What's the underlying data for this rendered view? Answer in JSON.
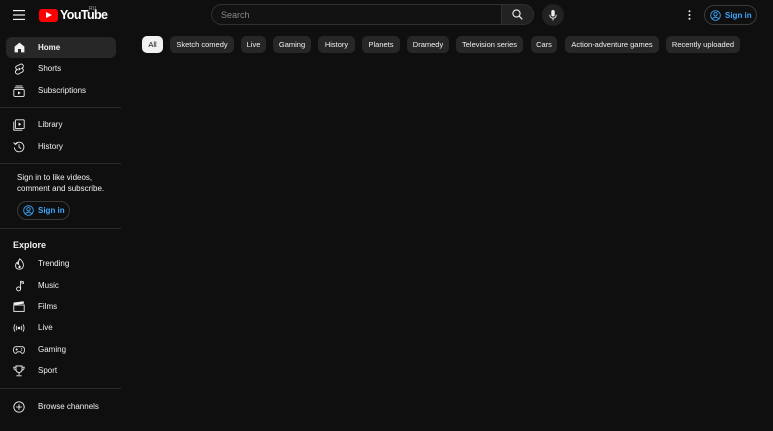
{
  "header": {
    "logo_text": "YouTube",
    "region": "RU",
    "search_placeholder": "Search",
    "sign_in_label": "Sign in",
    "icons": [
      "menu-icon",
      "search-icon",
      "mic-icon",
      "more-vert-icon",
      "account-icon"
    ]
  },
  "sidebar": {
    "main": [
      {
        "label": "Home",
        "icon": "home-icon",
        "active": true
      },
      {
        "label": "Shorts",
        "icon": "shorts-icon"
      },
      {
        "label": "Subscriptions",
        "icon": "subscriptions-icon"
      }
    ],
    "you": [
      {
        "label": "Library",
        "icon": "library-icon"
      },
      {
        "label": "History",
        "icon": "history-icon"
      }
    ],
    "signin_prompt": "Sign in to like videos, comment and subscribe.",
    "signin_label": "Sign in",
    "explore_heading": "Explore",
    "explore": [
      {
        "label": "Trending",
        "icon": "trending-icon"
      },
      {
        "label": "Music",
        "icon": "music-icon"
      },
      {
        "label": "Films",
        "icon": "films-icon"
      },
      {
        "label": "Live",
        "icon": "live-icon"
      },
      {
        "label": "Gaming",
        "icon": "gaming-icon"
      },
      {
        "label": "Sport",
        "icon": "sport-icon"
      }
    ],
    "browse_channels": {
      "label": "Browse channels",
      "icon": "add-circle-icon"
    }
  },
  "chips": [
    "All",
    "Sketch comedy",
    "Live",
    "Gaming",
    "History",
    "Planets",
    "Dramedy",
    "Television series",
    "Cars",
    "Action-adventure games",
    "Recently uploaded"
  ],
  "colors": {
    "background": "#0f0f0f",
    "chip": "#272727",
    "chip_active": "#f1f1f1",
    "link": "#3ea6ff",
    "brand": "#ff0000"
  }
}
